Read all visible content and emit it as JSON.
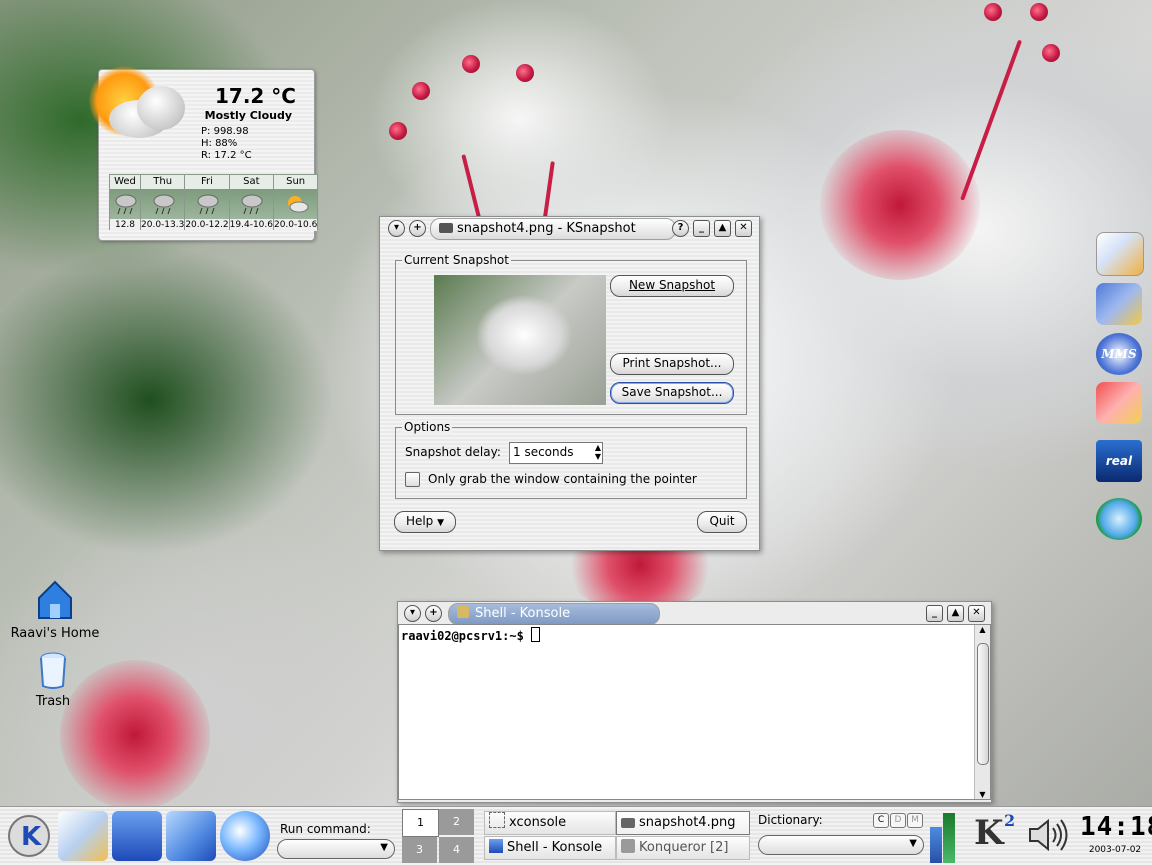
{
  "weather": {
    "temperature": "17.2 °C",
    "condition": "Mostly Cloudy",
    "pressure": "P:  998.98",
    "humidity": "H:      88%",
    "realfeel": "R: 17.2 °C",
    "forecast": [
      {
        "day": "Wed",
        "temps": "12.8",
        "icon": "rain-icon"
      },
      {
        "day": "Thu",
        "temps": "20.0-13.3",
        "icon": "rain-icon"
      },
      {
        "day": "Fri",
        "temps": "20.0-12.2",
        "icon": "rain-icon"
      },
      {
        "day": "Sat",
        "temps": "19.4-10.6",
        "icon": "rain-icon"
      },
      {
        "day": "Sun",
        "temps": "20.0-10.6",
        "icon": "sun-cloud-icon"
      }
    ]
  },
  "ksnapshot": {
    "title": "snapshot4.png - KSnapshot",
    "current_group": "Current Snapshot",
    "new_button": "New Snapshot",
    "print_button": "Print Snapshot...",
    "save_button": "Save Snapshot...",
    "options_group": "Options",
    "delay_label": "Snapshot delay:",
    "delay_value": "1 seconds",
    "only_window_label": "Only grab the window containing the pointer",
    "help_button": "Help",
    "quit_button": "Quit"
  },
  "konsole": {
    "title": "Shell - Konsole",
    "prompt": "raavi02@pcsrv1:~$ "
  },
  "desktop": {
    "home_label": "Raavi's Home",
    "trash_label": "Trash"
  },
  "panel": {
    "run_label": "Run command:",
    "pager": [
      "1",
      "2",
      "3",
      "4"
    ],
    "tasks": [
      {
        "label": "xconsole"
      },
      {
        "label": "snapshot4.png"
      },
      {
        "label": "Shell - Konsole"
      },
      {
        "label": "Konqueror [2]"
      }
    ],
    "dictionary_label": "Dictionary:",
    "dict_buttons": [
      "C",
      "D",
      "M"
    ],
    "clock_time": "14:18",
    "clock_date": "2003-07-02",
    "logo_label": "K",
    "logo_sup": "2"
  },
  "launchers": [
    "mail-icon",
    "editor-icon",
    "mms-icon",
    "notes-icon",
    "real-player-icon",
    "play-icon"
  ],
  "colors": {
    "accent": "#2a4fa8",
    "terminal_bg": "#ffffff"
  }
}
